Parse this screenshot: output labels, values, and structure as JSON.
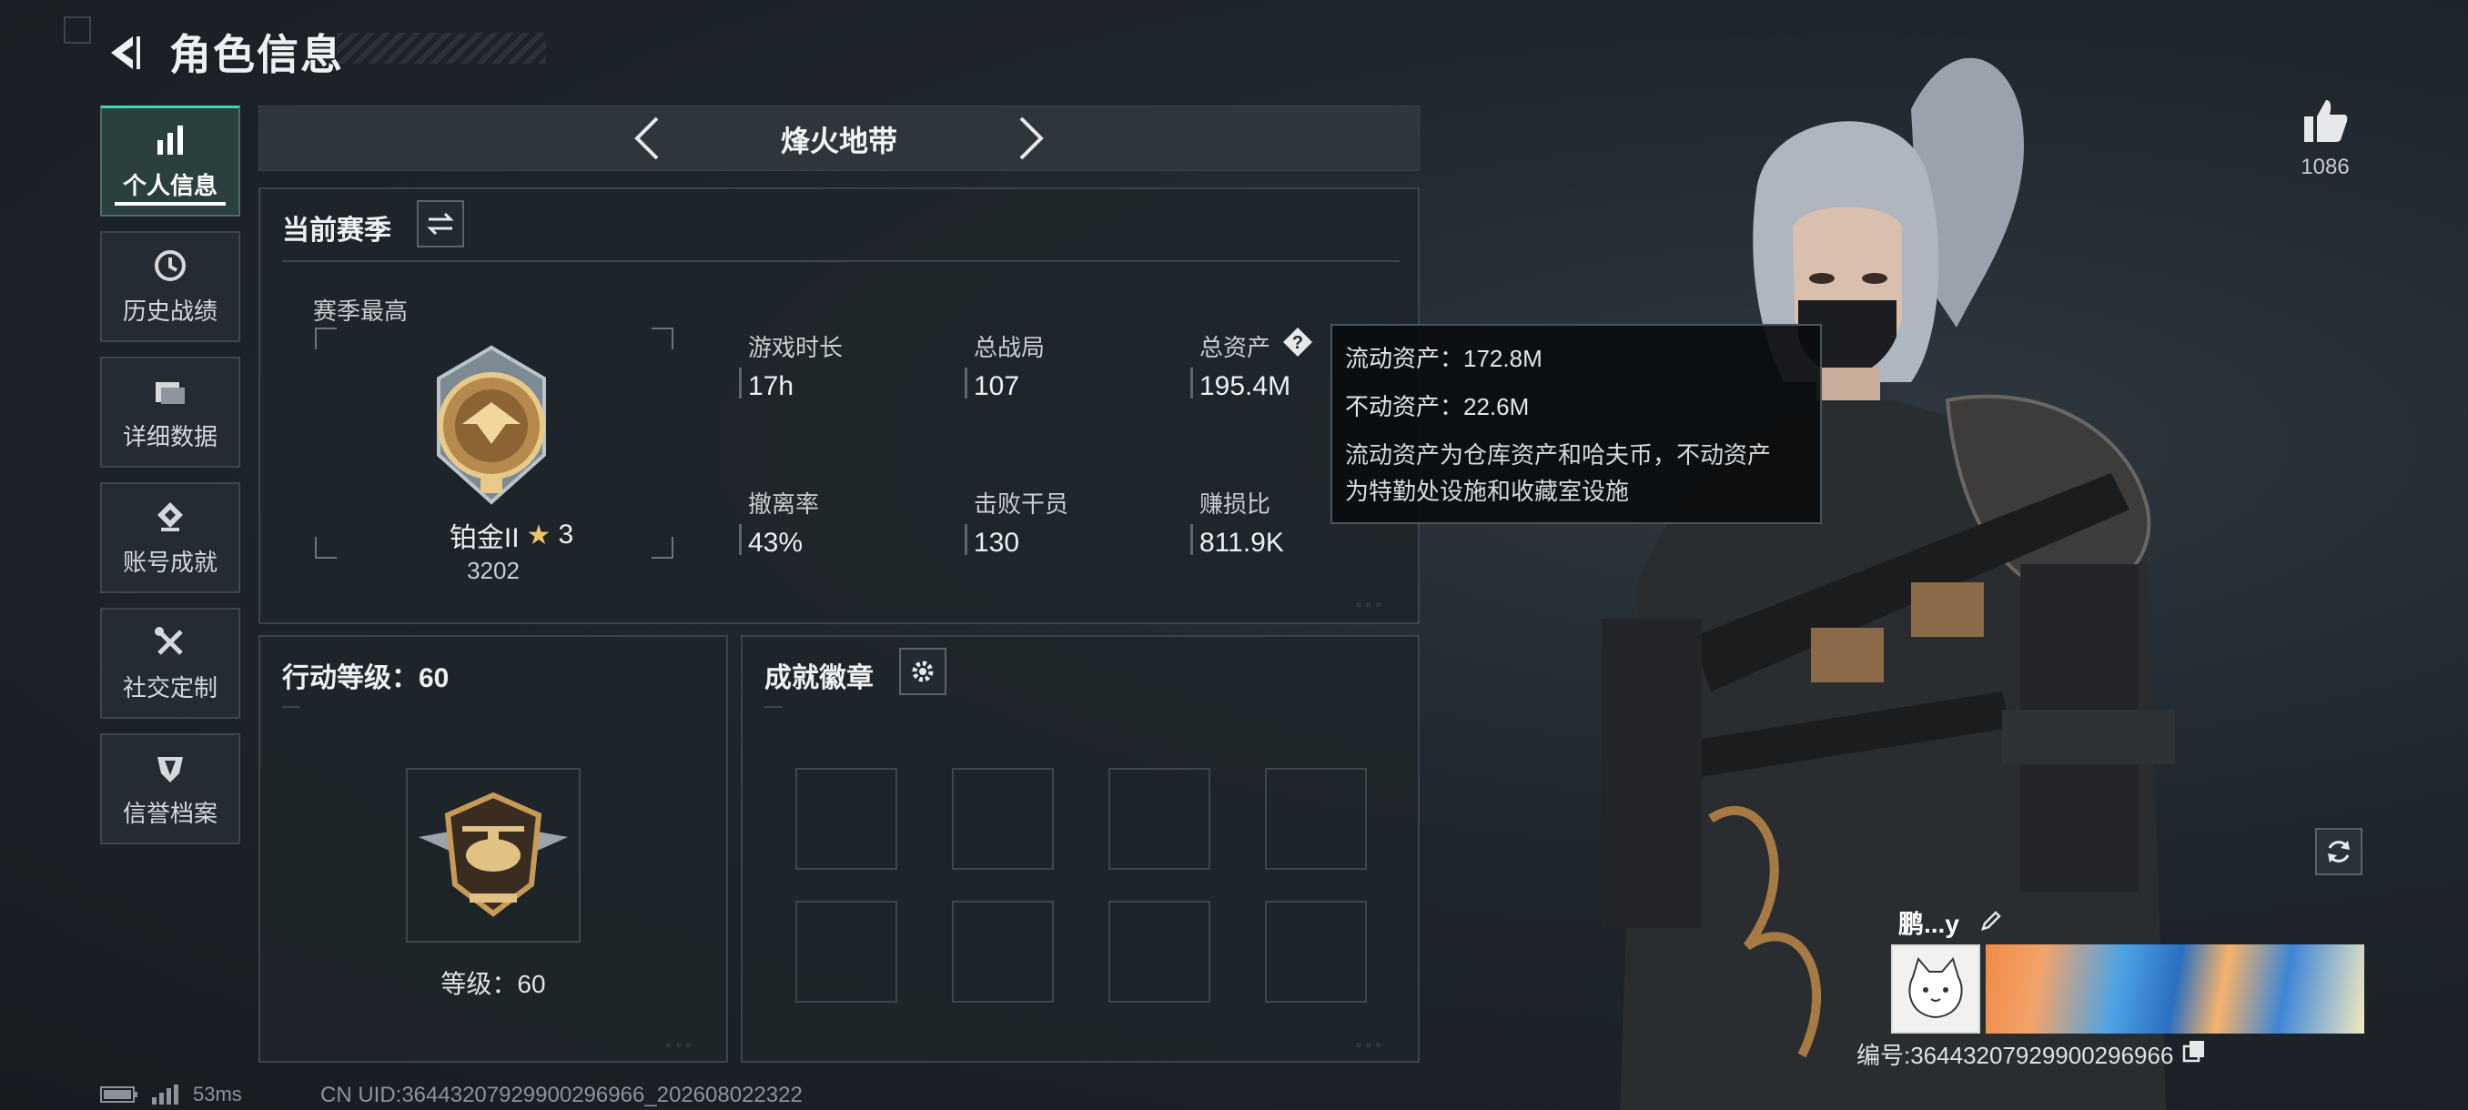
{
  "header": {
    "title": "角色信息",
    "back_icon": "back-arrow-icon"
  },
  "sidebar": {
    "items": [
      {
        "label": "个人信息",
        "icon": "bar-chart-icon",
        "active": true
      },
      {
        "label": "历史战绩",
        "icon": "clock-icon",
        "active": false
      },
      {
        "label": "详细数据",
        "icon": "folder-icon",
        "active": false
      },
      {
        "label": "账号成就",
        "icon": "badge-icon",
        "active": false
      },
      {
        "label": "社交定制",
        "icon": "tools-icon",
        "active": false
      },
      {
        "label": "信誉档案",
        "icon": "shield-icon",
        "active": false
      }
    ]
  },
  "mode": {
    "name": "烽火地带"
  },
  "season": {
    "title": "当前赛季",
    "best_label": "赛季最高",
    "rank_name": "铂金II",
    "rank_stars": "3",
    "rank_score": "3202",
    "stats": [
      {
        "label": "游戏时长",
        "value": "17h"
      },
      {
        "label": "总战局",
        "value": "107"
      },
      {
        "label": "总资产",
        "value": "195.4M"
      },
      {
        "label": "撤离率",
        "value": "43%"
      },
      {
        "label": "击败干员",
        "value": "130"
      },
      {
        "label": "赚损比",
        "value": "811.9K"
      }
    ]
  },
  "tooltip": {
    "liquid": "流动资产：172.8M",
    "fixed": "不动资产：22.6M",
    "desc_line1": "流动资产为仓库资产和哈夫币，不动资产",
    "desc_line2": "为特勤处设施和收藏室设施"
  },
  "action_level": {
    "title": "行动等级：60",
    "level_text": "等级：60"
  },
  "achievements": {
    "title": "成就徽章",
    "slot_count": 8
  },
  "likes": {
    "count": "1086"
  },
  "card": {
    "name": "鹏...y",
    "id": "编号:3644320792990029​6966"
  },
  "footer": {
    "ping": "53ms",
    "uid": "CN UID:36443207929900296966_202608022322"
  },
  "colors": {
    "accent": "#3fd3b8",
    "panel": "#1f252a",
    "border": "#3b444b"
  }
}
